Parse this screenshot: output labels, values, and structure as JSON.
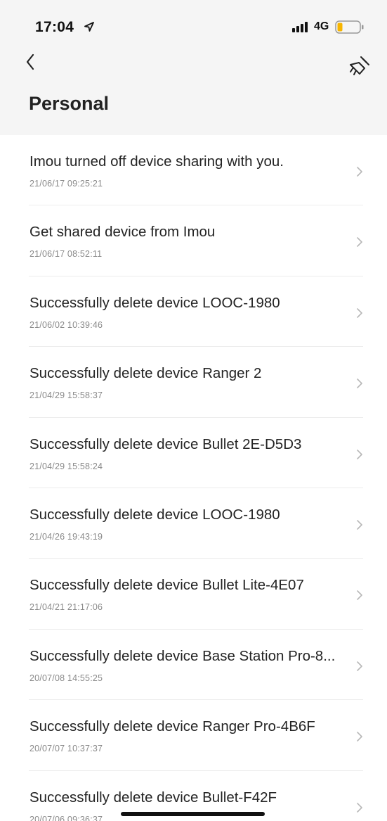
{
  "status_bar": {
    "time": "17:04",
    "network": "4G",
    "location_icon": "location-arrow-icon",
    "signal_icon": "cellular-signal-icon",
    "battery_icon": "battery-low-icon",
    "battery_color": "#f7b500"
  },
  "nav": {
    "back_icon": "chevron-left-icon",
    "clear_icon": "broom-clear-icon"
  },
  "page": {
    "title": "Personal"
  },
  "messages": [
    {
      "title": "Imou turned off device sharing with you.",
      "time": "21/06/17  09:25:21"
    },
    {
      "title": "Get shared device from Imou",
      "time": "21/06/17  08:52:11"
    },
    {
      "title": "Successfully delete device LOOC-1980",
      "time": "21/06/02  10:39:46"
    },
    {
      "title": "Successfully delete device Ranger 2",
      "time": "21/04/29  15:58:37"
    },
    {
      "title": "Successfully delete device Bullet 2E-D5D3",
      "time": "21/04/29  15:58:24"
    },
    {
      "title": "Successfully delete device LOOC-1980",
      "time": "21/04/26  19:43:19"
    },
    {
      "title": "Successfully delete device Bullet Lite-4E07",
      "time": "21/04/21  21:17:06"
    },
    {
      "title": "Successfully delete device Base Station Pro-8...",
      "time": "20/07/08  14:55:25"
    },
    {
      "title": "Successfully delete device Ranger Pro-4B6F",
      "time": "20/07/07  10:37:37"
    },
    {
      "title": "Successfully delete device Bullet-F42F",
      "time": "20/07/06  09:36:37"
    }
  ]
}
